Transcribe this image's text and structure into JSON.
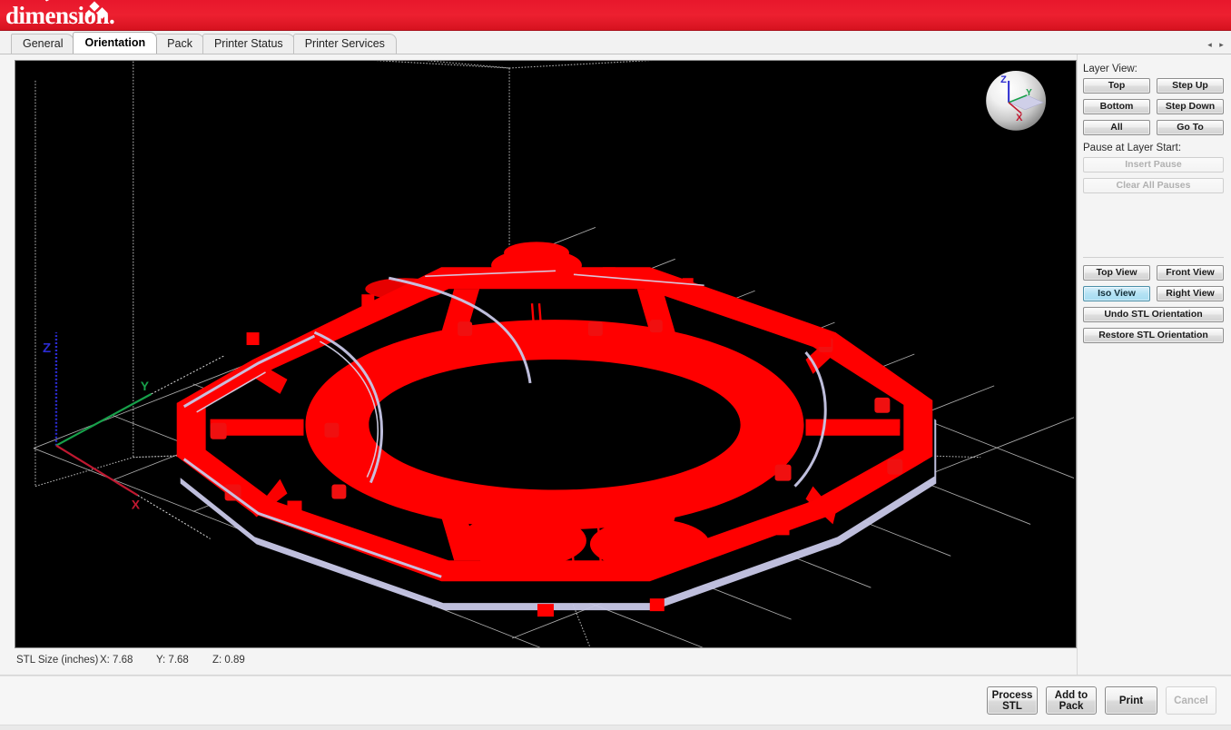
{
  "app": {
    "brand": "dimension.",
    "banner_color": "#ED2030"
  },
  "tabs": [
    {
      "label": "General",
      "active": false
    },
    {
      "label": "Orientation",
      "active": true
    },
    {
      "label": "Pack",
      "active": false
    },
    {
      "label": "Printer Status",
      "active": false
    },
    {
      "label": "Printer Services",
      "active": false
    }
  ],
  "tab_scroll": {
    "left": "◂",
    "right": "▸"
  },
  "viewport": {
    "background": "#000000",
    "model_color": "#FF0000",
    "support_color": "#C8C8E8",
    "grid_color": "#C9C9C9",
    "axes": {
      "x": "X",
      "y": "Y",
      "z": "Z",
      "x_color": "#C01830",
      "y_color": "#17A04A",
      "z_color": "#2B2BD0"
    },
    "navball": {
      "x": "X",
      "y": "Y",
      "z": "Z"
    }
  },
  "status": {
    "label": "STL Size (inches)",
    "x": "X:  7.68",
    "y": "Y:  7.68",
    "z": "Z:  0.89"
  },
  "panel": {
    "layer_view_label": "Layer View:",
    "layer_buttons": [
      {
        "label": "Top",
        "enabled": true
      },
      {
        "label": "Step Up",
        "enabled": true
      },
      {
        "label": "Bottom",
        "enabled": true
      },
      {
        "label": "Step Down",
        "enabled": true
      },
      {
        "label": "All",
        "enabled": true
      },
      {
        "label": "Go To",
        "enabled": true
      }
    ],
    "pause_label": "Pause at Layer Start:",
    "pause_buttons": [
      {
        "label": "Insert Pause",
        "enabled": false
      },
      {
        "label": "Clear All Pauses",
        "enabled": false
      }
    ],
    "view_buttons": [
      {
        "label": "Top View",
        "selected": false
      },
      {
        "label": "Front View",
        "selected": false
      },
      {
        "label": "Iso View",
        "selected": true
      },
      {
        "label": "Right View",
        "selected": false
      }
    ],
    "orientation_buttons": [
      {
        "label": "Undo STL Orientation"
      },
      {
        "label": "Restore STL Orientation"
      }
    ]
  },
  "footer": {
    "buttons": [
      {
        "label": "Process STL",
        "line1": "Process",
        "line2": "STL",
        "enabled": true
      },
      {
        "label": "Add to Pack",
        "line1": "Add to",
        "line2": "Pack",
        "enabled": true
      },
      {
        "label": "Print",
        "line1": "Print",
        "line2": "",
        "enabled": true
      },
      {
        "label": "Cancel",
        "line1": "Cancel",
        "line2": "",
        "enabled": false
      }
    ]
  }
}
